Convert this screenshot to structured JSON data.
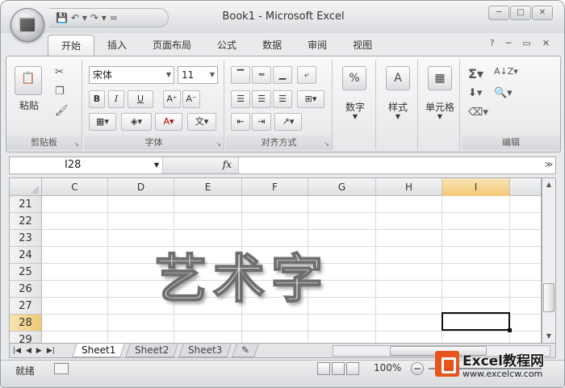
{
  "window": {
    "title": "Book1 - Microsoft Excel",
    "quick_access": [
      "💾",
      "↶ ▾",
      "↷ ▾",
      "="
    ],
    "controls": [
      "─",
      "□",
      "✕"
    ]
  },
  "ribbon": {
    "tabs": [
      "开始",
      "插入",
      "页面布局",
      "公式",
      "数据",
      "审阅",
      "视图"
    ],
    "active_tab": "开始",
    "right_icons": [
      "?",
      "─",
      "▭",
      "✕"
    ],
    "clipboard": {
      "label": "剪贴板",
      "paste": "粘贴"
    },
    "font": {
      "label": "字体",
      "name": "宋体",
      "size": "11",
      "bold": "B",
      "italic": "I",
      "underline": "U",
      "grow": "A⁺",
      "shrink": "A⁻",
      "phonetic": "文"
    },
    "alignment": {
      "label": "对齐方式"
    },
    "number": {
      "label": "数字",
      "percent": "%"
    },
    "styles": {
      "label": "样式"
    },
    "cells": {
      "label": "单元格"
    },
    "editing": {
      "label": "编辑",
      "sum": "Σ",
      "sort": "A↓Z"
    }
  },
  "formula_bar": {
    "name_box": "I28",
    "fx": "fx",
    "value": ""
  },
  "grid": {
    "columns": [
      "C",
      "D",
      "E",
      "F",
      "G",
      "H",
      "I"
    ],
    "rows": [
      "21",
      "22",
      "23",
      "24",
      "25",
      "26",
      "27",
      "28",
      "29"
    ],
    "selected_column": "I",
    "selected_row": "28",
    "wordart_text": "艺术字"
  },
  "sheets": {
    "tabs": [
      "Sheet1",
      "Sheet2",
      "Sheet3"
    ],
    "active": "Sheet1",
    "nav": [
      "|◀",
      "◀",
      "▶",
      "▶|"
    ]
  },
  "status": {
    "mode": "就绪",
    "zoom": "100%",
    "zoom_minus": "−"
  },
  "watermark": {
    "title": "Excel教程网",
    "url": "www.excelcw.com"
  }
}
